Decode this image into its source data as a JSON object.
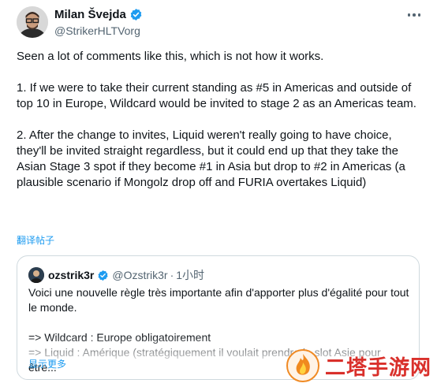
{
  "author": {
    "name": "Milan Švejda",
    "handle": "@StrikerHLTVorg",
    "verified": true
  },
  "tweet": {
    "paragraphs": [
      "Seen a lot of comments like this, which is not how it works.",
      "1. If we were to take their current standing as #5 in Americas and outside of top 10 in Europe, Wildcard would be invited to stage 2 as an Americas team.",
      "2. After the change to invites, Liquid weren't really going to have choice, they'll be invited straight regardless, but it could end up that they take the Asian Stage 3 spot if they become #1 in Asia but drop to #2 in Americas (a plausible scenario if Mongolz drop off and FURIA overtakes Liquid)"
    ],
    "translate_label": "翻译帖子"
  },
  "quote": {
    "name": "ozstrik3r",
    "handle": "@Ozstrik3r",
    "separator": "·",
    "time": "1小时",
    "verified": true,
    "lines": [
      "Voici une nouvelle règle très importante afin d'apporter plus d'égalité pour tout le monde.",
      "=> Wildcard : Europe obligatoirement",
      "=> Liquid : Amérique (stratégiquement il voulait prendre le slot Asie pour être..."
    ],
    "show_more_label": "显示更多"
  },
  "watermark": {
    "text": "二塔手游网"
  },
  "colors": {
    "accent": "#1d9bf0",
    "text": "#0f1419",
    "secondary": "#536471",
    "border": "#cfd9de",
    "watermark": "#d9302b"
  },
  "icons": {
    "verified": "verified-badge-icon",
    "more": "more-options-icon",
    "watermark_logo": "flame-logo-icon"
  }
}
